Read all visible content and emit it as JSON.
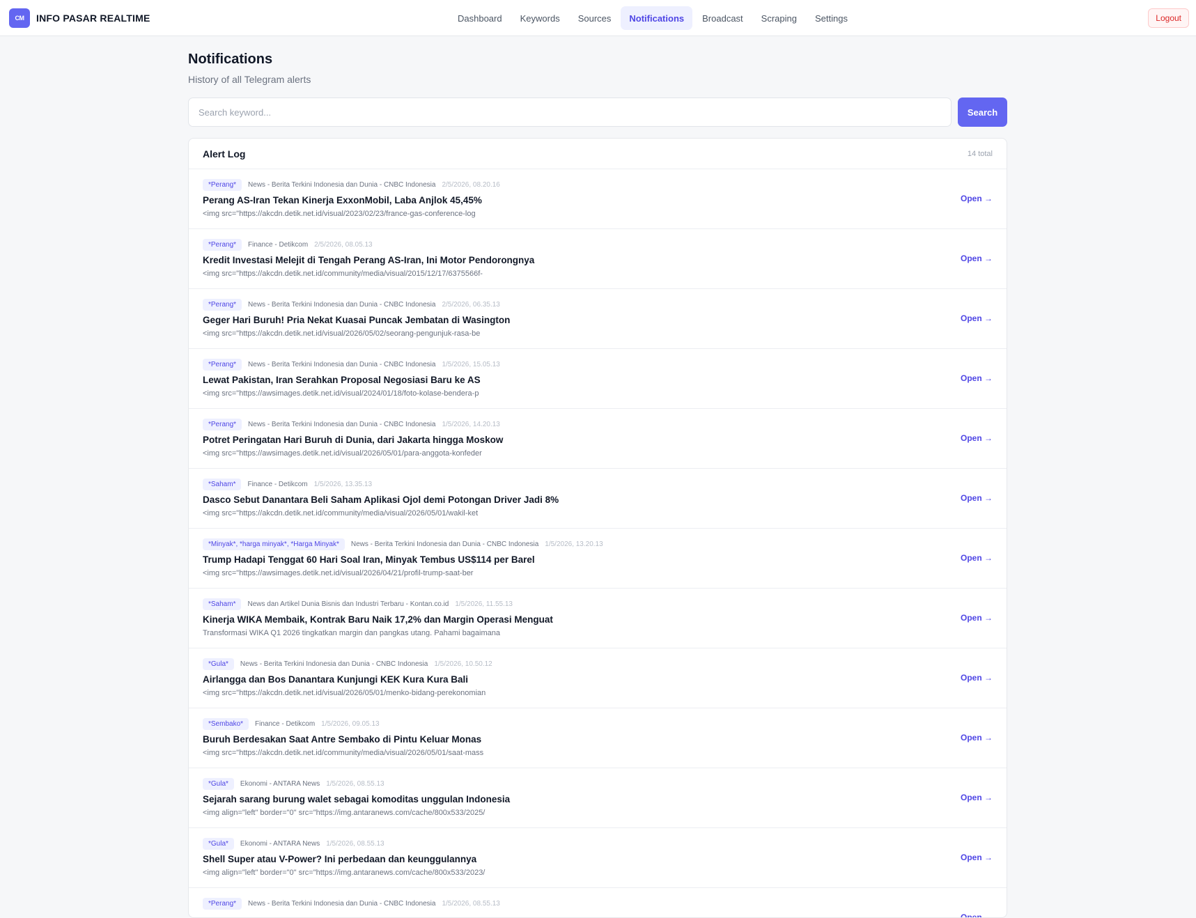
{
  "brand": {
    "logo_text": "CM",
    "name": "INFO PASAR REALTIME"
  },
  "nav": [
    {
      "label": "Dashboard",
      "active": false
    },
    {
      "label": "Keywords",
      "active": false
    },
    {
      "label": "Sources",
      "active": false
    },
    {
      "label": "Notifications",
      "active": true
    },
    {
      "label": "Broadcast",
      "active": false
    },
    {
      "label": "Scraping",
      "active": false
    },
    {
      "label": "Settings",
      "active": false
    }
  ],
  "logout_label": "Logout",
  "page": {
    "title": "Notifications",
    "subtitle": "History of all Telegram alerts"
  },
  "search": {
    "placeholder": "Search keyword...",
    "value": "",
    "button_label": "Search"
  },
  "alert_log": {
    "title": "Alert Log",
    "count_label": "14 total",
    "open_label": "Open →",
    "items": [
      {
        "tag": "*Perang*",
        "source": "News - Berita Terkini Indonesia dan Dunia - CNBC Indonesia",
        "time": "2/5/2026, 08.20.16",
        "title": "Perang AS-Iran Tekan Kinerja ExxonMobil, Laba Anjlok 45,45%",
        "snippet": "<img src=\"https://akcdn.detik.net.id/visual/2023/02/23/france-gas-conference-log"
      },
      {
        "tag": "*Perang*",
        "source": "Finance - Detikcom",
        "time": "2/5/2026, 08.05.13",
        "title": "Kredit Investasi Melejit di Tengah Perang AS-Iran, Ini Motor Pendorongnya",
        "snippet": "<img src=\"https://akcdn.detik.net.id/community/media/visual/2015/12/17/6375566f-"
      },
      {
        "tag": "*Perang*",
        "source": "News - Berita Terkini Indonesia dan Dunia - CNBC Indonesia",
        "time": "2/5/2026, 06.35.13",
        "title": "Geger Hari Buruh! Pria Nekat Kuasai Puncak Jembatan di Wasington",
        "snippet": "<img src=\"https://akcdn.detik.net.id/visual/2026/05/02/seorang-pengunjuk-rasa-be"
      },
      {
        "tag": "*Perang*",
        "source": "News - Berita Terkini Indonesia dan Dunia - CNBC Indonesia",
        "time": "1/5/2026, 15.05.13",
        "title": "Lewat Pakistan, Iran Serahkan Proposal Negosiasi Baru ke AS",
        "snippet": "<img src=\"https://awsimages.detik.net.id/visual/2024/01/18/foto-kolase-bendera-p"
      },
      {
        "tag": "*Perang*",
        "source": "News - Berita Terkini Indonesia dan Dunia - CNBC Indonesia",
        "time": "1/5/2026, 14.20.13",
        "title": "Potret Peringatan Hari Buruh di Dunia, dari Jakarta hingga Moskow",
        "snippet": "<img src=\"https://awsimages.detik.net.id/visual/2026/05/01/para-anggota-konfeder"
      },
      {
        "tag": "*Saham*",
        "source": "Finance - Detikcom",
        "time": "1/5/2026, 13.35.13",
        "title": "Dasco Sebut Danantara Beli Saham Aplikasi Ojol demi Potongan Driver Jadi 8%",
        "snippet": "<img src=\"https://akcdn.detik.net.id/community/media/visual/2026/05/01/wakil-ket"
      },
      {
        "tag": "*Minyak*, *harga minyak*, *Harga Minyak*",
        "source": "News - Berita Terkini Indonesia dan Dunia - CNBC Indonesia",
        "time": "1/5/2026, 13.20.13",
        "title": "Trump Hadapi Tenggat 60 Hari Soal Iran, Minyak Tembus US$114 per Barel",
        "snippet": "<img src=\"https://awsimages.detik.net.id/visual/2026/04/21/profil-trump-saat-ber"
      },
      {
        "tag": "*Saham*",
        "source": "News dan Artikel Dunia Bisnis dan Industri Terbaru - Kontan.co.id",
        "time": "1/5/2026, 11.55.13",
        "title": "Kinerja WIKA Membaik, Kontrak Baru Naik 17,2% dan Margin Operasi Menguat",
        "snippet": "Transformasi WIKA Q1 2026 tingkatkan margin dan pangkas utang. Pahami bagaimana"
      },
      {
        "tag": "*Gula*",
        "source": "News - Berita Terkini Indonesia dan Dunia - CNBC Indonesia",
        "time": "1/5/2026, 10.50.12",
        "title": "Airlangga dan Bos Danantara Kunjungi KEK Kura Kura Bali",
        "snippet": "<img src=\"https://akcdn.detik.net.id/visual/2026/05/01/menko-bidang-perekonomian"
      },
      {
        "tag": "*Sembako*",
        "source": "Finance - Detikcom",
        "time": "1/5/2026, 09.05.13",
        "title": "Buruh Berdesakan Saat Antre Sembako di Pintu Keluar Monas",
        "snippet": "<img src=\"https://akcdn.detik.net.id/community/media/visual/2026/05/01/saat-mass"
      },
      {
        "tag": "*Gula*",
        "source": "Ekonomi - ANTARA News",
        "time": "1/5/2026, 08.55.13",
        "title": "Sejarah sarang burung walet sebagai komoditas unggulan Indonesia",
        "snippet": "<img align=\"left\" border=\"0\" src=\"https://img.antaranews.com/cache/800x533/2025/"
      },
      {
        "tag": "*Gula*",
        "source": "Ekonomi - ANTARA News",
        "time": "1/5/2026, 08.55.13",
        "title": "Shell Super atau V-Power? Ini perbedaan dan keunggulannya",
        "snippet": "<img align=\"left\" border=\"0\" src=\"https://img.antaranews.com/cache/800x533/2023/"
      },
      {
        "tag": "*Perang*",
        "source": "News - Berita Terkini Indonesia dan Dunia - CNBC Indonesia",
        "time": "1/5/2026, 08.55.13",
        "title": "",
        "snippet": ""
      }
    ]
  }
}
